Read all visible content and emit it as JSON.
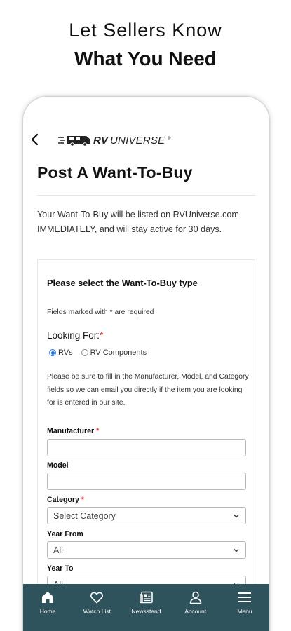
{
  "promo": {
    "line1": "Let Sellers Know",
    "line2": "What You Need"
  },
  "header": {
    "logo_text": "RVUNIVERSE"
  },
  "page": {
    "title": "Post A Want-To-Buy",
    "intro": "Your Want-To-Buy will be listed on RVUniverse.com IMMEDIATELY, and will stay active for 30 days."
  },
  "form": {
    "type_heading": "Please select the Want-To-Buy type",
    "required_note": "Fields marked with * are required",
    "looking_for_label": "Looking For:",
    "looking_for_options": [
      {
        "label": "RVs",
        "selected": true
      },
      {
        "label": "RV Components",
        "selected": false
      }
    ],
    "hint": "Please be sure to fill in the Manufacturer, Model, and Category fields so we can email you directly if the item you are looking for is entered in our site.",
    "manufacturer_label": "Manufacturer",
    "manufacturer_value": "",
    "model_label": "Model",
    "model_value": "",
    "category_label": "Category",
    "category_value": "Select Category",
    "year_from_label": "Year From",
    "year_from_value": "All",
    "year_to_label": "Year To",
    "year_to_value": "All",
    "required_marker": "*"
  },
  "nav": {
    "items": [
      {
        "label": "Home",
        "icon": "home-icon"
      },
      {
        "label": "Watch List",
        "icon": "heart-icon"
      },
      {
        "label": "Newsstand",
        "icon": "newspaper-icon"
      },
      {
        "label": "Account",
        "icon": "user-icon"
      },
      {
        "label": "Menu",
        "icon": "hamburger-icon"
      }
    ]
  },
  "colors": {
    "nav_bg": "#2e535c",
    "required": "#e03030",
    "radio_selected": "#1a73e8"
  }
}
